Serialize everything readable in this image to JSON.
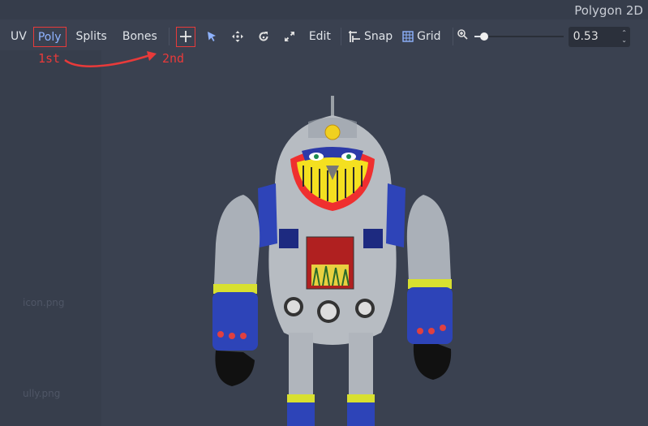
{
  "dialog": {
    "title": "Polygon 2D"
  },
  "toolbar": {
    "modes": [
      "UV",
      "Poly",
      "Splits",
      "Bones"
    ],
    "active_mode": "Poly",
    "edit_label": "Edit",
    "snap_label": "Snap",
    "grid_label": "Grid",
    "zoom_value": "0.53",
    "zoom_level": 0.53
  },
  "annotations": {
    "first": "1st",
    "second": "2nd"
  },
  "background": {
    "file_1": "icon.png",
    "file_2": "ully.png"
  },
  "colors": {
    "bg": "#3a4150",
    "accent": "#8fb3ff",
    "annotation": "#e83a3a"
  }
}
